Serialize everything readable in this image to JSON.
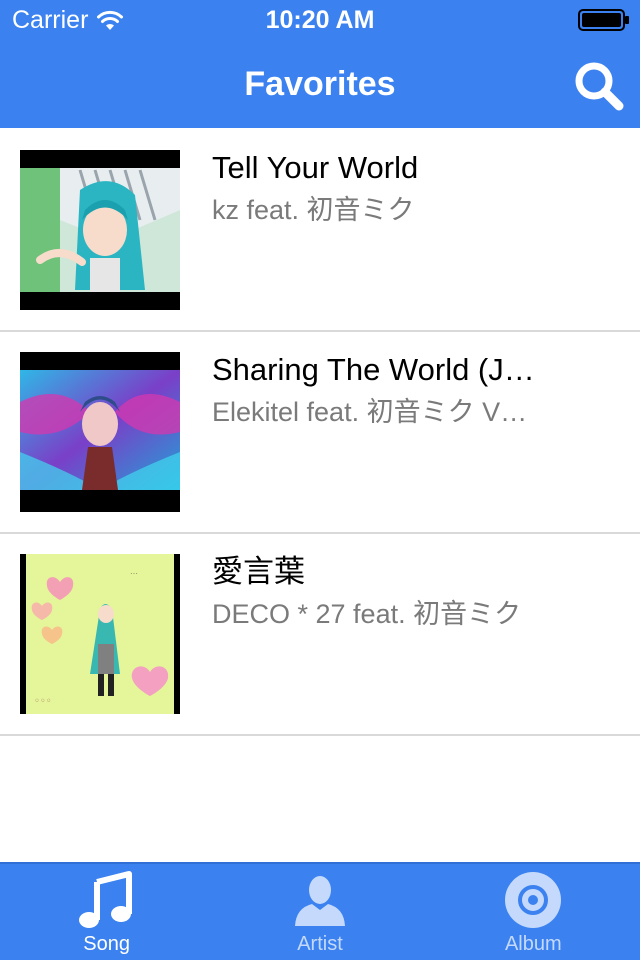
{
  "status_bar": {
    "carrier": "Carrier",
    "time": "10:20 AM",
    "wifi_icon": "wifi-icon",
    "battery_icon": "battery-icon"
  },
  "nav": {
    "title": "Favorites",
    "search_icon": "search-icon"
  },
  "songs": [
    {
      "title": "Tell Your World",
      "artist": "kz feat. 初音ミク"
    },
    {
      "title": "Sharing The World (J…",
      "artist": "Elekitel feat. 初音ミク V…"
    },
    {
      "title": "愛言葉",
      "artist": "DECO * 27 feat. 初音ミク"
    }
  ],
  "tabs": [
    {
      "label": "Song",
      "icon": "music-note-icon",
      "active": true
    },
    {
      "label": "Artist",
      "icon": "person-icon",
      "active": false
    },
    {
      "label": "Album",
      "icon": "album-disc-icon",
      "active": false
    }
  ],
  "colors": {
    "brand_blue": "#3b82f0",
    "title_text": "#000000",
    "subtitle_text": "#7a7a7a",
    "active_tab": "#ffffff",
    "inactive_tab": "#c4d9fb"
  }
}
